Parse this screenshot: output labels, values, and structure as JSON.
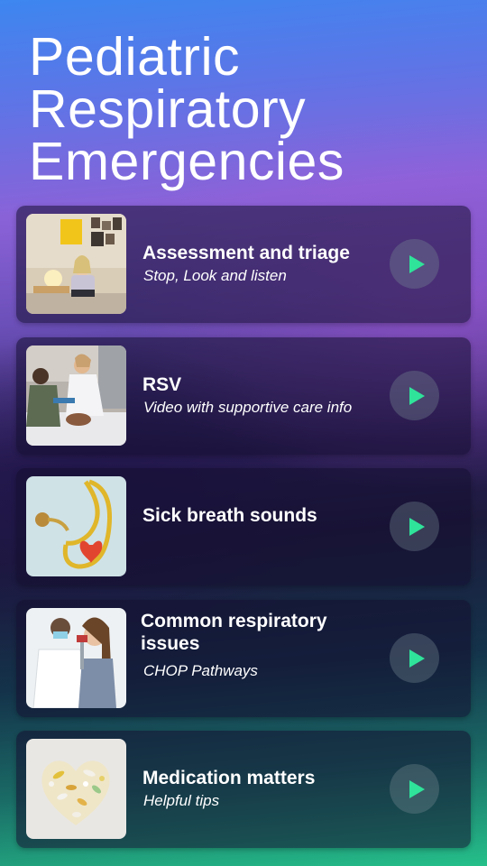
{
  "page": {
    "title_lines": [
      "Pediatric",
      "Respiratory",
      "Emergencies"
    ]
  },
  "cards": [
    {
      "title": "Assessment and triage",
      "subtitle": "Stop, Look and listen",
      "thumb_icon": "teen-with-laptop-photo"
    },
    {
      "title": "RSV",
      "subtitle": "Video with  supportive care info",
      "thumb_icon": "nurses-with-infant-photo"
    },
    {
      "title": "Sick breath sounds",
      "subtitle": "",
      "thumb_icon": "stethoscope-heart-photo"
    },
    {
      "title": "Common respiratory issues",
      "subtitle": "CHOP Pathways",
      "thumb_icon": "doctor-child-inhaler-photo"
    },
    {
      "title": "Medication matters",
      "subtitle": "Helpful tips",
      "thumb_icon": "pills-heart-photo"
    }
  ],
  "colors": {
    "play_icon": "#2fe39a",
    "gradient_top": "#3d86f0",
    "gradient_bottom": "#25c08a"
  }
}
